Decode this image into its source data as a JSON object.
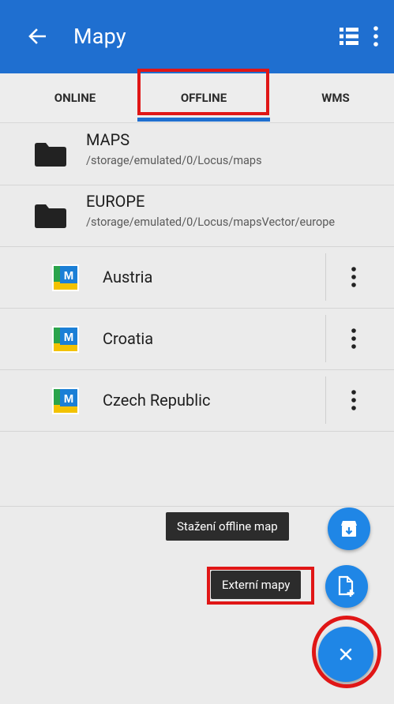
{
  "appbar": {
    "title": "Mapy",
    "back_icon": "arrow-left-icon",
    "list_icon": "list-view-icon",
    "more_icon": "more-vert-icon",
    "color": "#1f6fd0"
  },
  "tabs": [
    {
      "label": "ONLINE"
    },
    {
      "label": "OFFLINE",
      "selected": true
    },
    {
      "label": "WMS"
    }
  ],
  "folders": [
    {
      "title": "MAPS",
      "path": "/storage/emulated/0/Locus/maps"
    },
    {
      "title": "EUROPE",
      "path": "/storage/emulated/0/Locus/mapsVector/europe"
    }
  ],
  "maps": [
    {
      "name": "Austria"
    },
    {
      "name": "Croatia"
    },
    {
      "name": "Czech Republic"
    }
  ],
  "fab_menu": {
    "download": {
      "label": "Stažení offline map",
      "icon": "store-download-icon"
    },
    "external": {
      "label": "Externí mapy",
      "icon": "add-file-icon"
    },
    "close_icon": "close-icon"
  },
  "colors": {
    "highlight": "#e01616",
    "fab": "#1f86e6"
  }
}
